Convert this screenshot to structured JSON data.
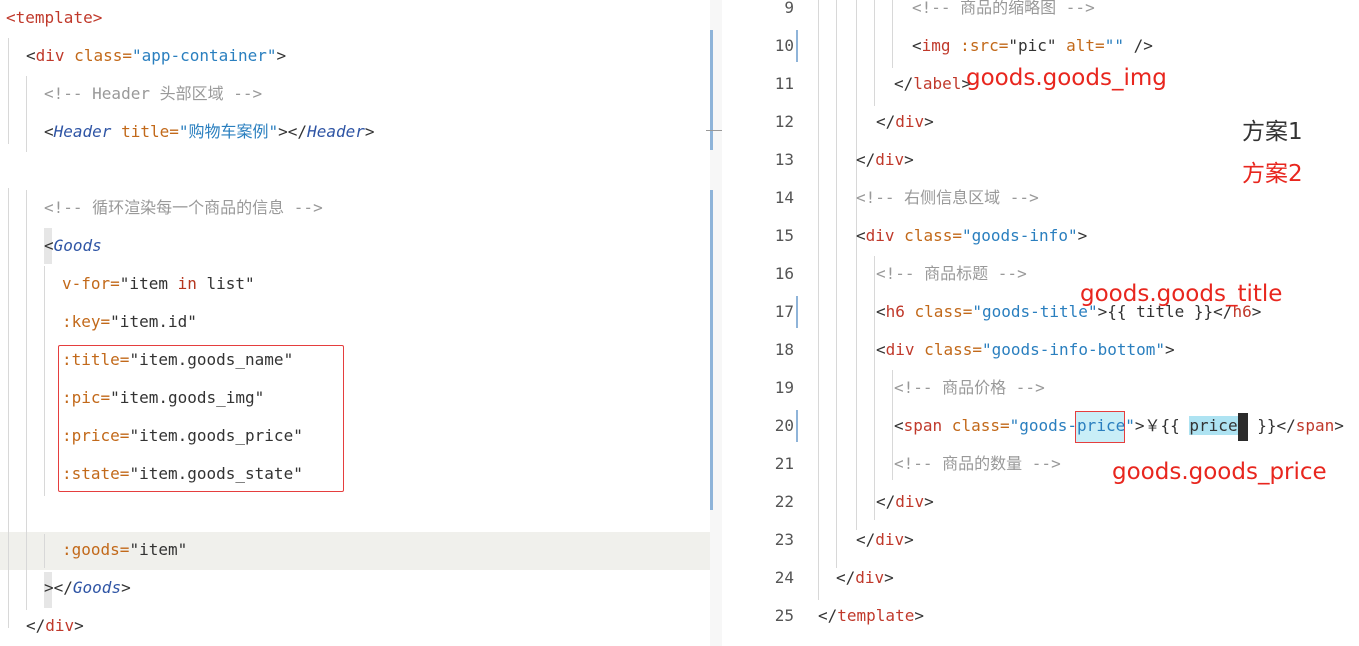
{
  "left": {
    "lines": [
      {
        "a": "<",
        "b": "template",
        "c": ">"
      },
      {
        "a": "<",
        "b": "div",
        "c": " class=",
        "d": "\"app-container\"",
        "e": ">"
      },
      {
        "comment": "<!-- Header 头部区域 -->"
      },
      {
        "a": "<",
        "i": "Header",
        "c": " title=",
        "d": "\"购物车案例\"",
        "e": "></",
        "i2": "Header",
        "f": ">"
      },
      {
        "comment": "<!-- 循环渲染每一个商品的信息 -->"
      },
      {
        "a": "<",
        "i": "Goods"
      },
      {
        "attr": "v-for=",
        "str": "\"item ",
        "kw": "in",
        "str2": " list\""
      },
      {
        "attr": ":key=",
        "str": "\"item.id\""
      },
      {
        "attr": ":title=",
        "str": "\"item.goods_name\""
      },
      {
        "attr": ":pic=",
        "str": "\"item.goods_img\""
      },
      {
        "attr": ":price=",
        "str": "\"item.goods_price\""
      },
      {
        "attr": ":state=",
        "str": "\"item.goods_state\""
      },
      {
        "attr": ":goods=",
        "str": "\"item\""
      },
      {
        "a": "></",
        "i": "Goods",
        "c": ">"
      },
      {
        "a": "</",
        "b": "div",
        "c": ">"
      }
    ]
  },
  "right": {
    "line_numbers": [
      "9",
      "10",
      "11",
      "12",
      "13",
      "14",
      "15",
      "16",
      "17",
      "18",
      "19",
      "20",
      "21",
      "22",
      "23",
      "24",
      "25"
    ],
    "lines": [
      {
        "comment": "<!-- 商品的缩略图 -->"
      },
      {
        "a": "<",
        "b": "img",
        "c": " :src=",
        "d": "\"pic\"",
        "e": " alt=",
        "f": "\"\"",
        "g": " />"
      },
      {
        "a": "</",
        "b": "label",
        "c": ">"
      },
      {
        "a": "</",
        "b": "div",
        "c": ">"
      },
      {
        "a": "</",
        "b": "div",
        "c": ">"
      },
      {
        "comment": "<!-- 右侧信息区域 -->"
      },
      {
        "a": "<",
        "b": "div",
        "c": " class=",
        "d": "\"goods-info\"",
        "e": ">"
      },
      {
        "comment": "<!-- 商品标题 -->"
      },
      {
        "a": "<",
        "b": "h6",
        "c": " class=",
        "d": "\"goods-title\"",
        "e": ">{{ title }}</",
        "f": "h6",
        "g": ">"
      },
      {
        "a": "<",
        "b": "div",
        "c": " class=",
        "d": "\"goods-info-bottom\"",
        "e": ">"
      },
      {
        "comment": "<!-- 商品价格 -->"
      },
      {
        "a": "<",
        "b": "span",
        "c": " class=",
        "d1": "\"goods-",
        "d2": "price",
        "d3": "\"",
        "e": ">￥{{ ",
        "sel": "price",
        "f": " }}</",
        "g": "span",
        "h": ">"
      },
      {
        "comment": "<!-- 商品的数量 -->"
      },
      {
        "a": "</",
        "b": "div",
        "c": ">"
      },
      {
        "a": "</",
        "b": "div",
        "c": ">"
      },
      {
        "a": "</",
        "b": "div",
        "c": ">"
      },
      {
        "a": "</",
        "b": "template",
        "c": ">"
      }
    ]
  },
  "notes": {
    "goods_img": "goods.goods_img",
    "goods_title": "goods.goods_title",
    "goods_price": "goods.goods_price",
    "plan1": "方案1",
    "plan2": "方案2"
  }
}
